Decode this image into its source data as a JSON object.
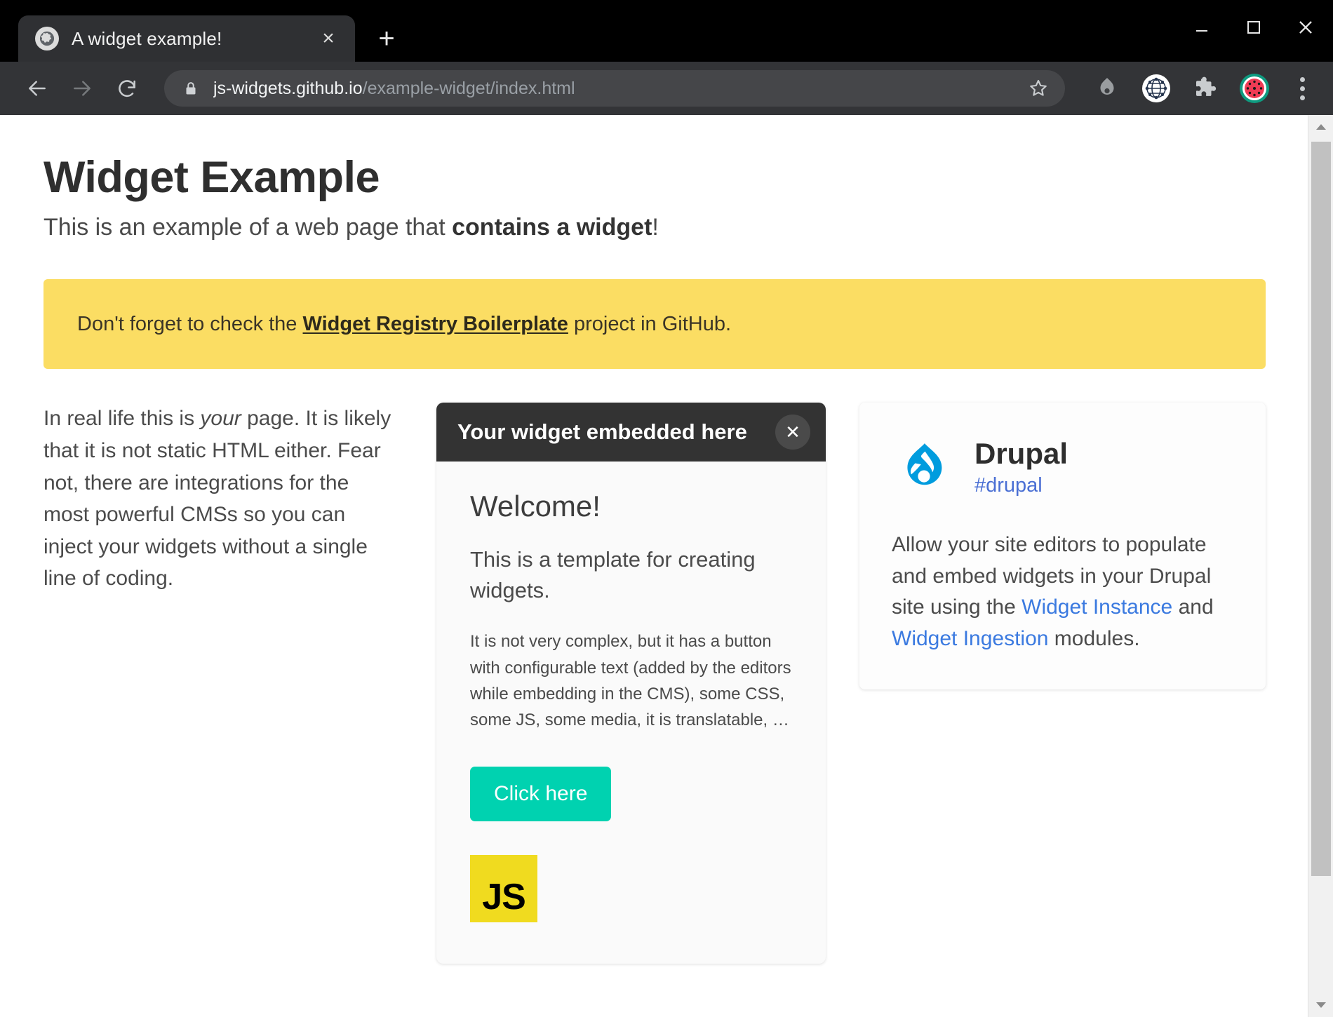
{
  "browser": {
    "tab": {
      "title": "A widget example!",
      "favicon": "globe-icon",
      "close_label": "×"
    },
    "new_tab_label": "+",
    "window_controls": {
      "minimize": "–",
      "maximize": "□",
      "close": "✕"
    },
    "omnibox": {
      "host": "js-widgets.github.io",
      "path": "/example-widget/index.html",
      "lock_icon": "lock-icon",
      "star_icon": "bookmark-star-icon"
    },
    "nav": {
      "back": "back-arrow-icon",
      "forward": "forward-arrow-icon",
      "reload": "reload-icon"
    },
    "extensions": [
      {
        "name": "drupal-extension-icon"
      },
      {
        "name": "globe-network-extension-icon"
      },
      {
        "name": "puzzle-extensions-icon"
      },
      {
        "name": "watermelon-profile-avatar"
      }
    ],
    "menu_icon": "three-dot-menu-icon"
  },
  "page": {
    "title": "Widget Example",
    "subtitle_pre": "This is an example of a web page that ",
    "subtitle_strong": "contains a widget",
    "subtitle_post": "!",
    "alert": {
      "pre": "Don't forget to check the ",
      "link": "Widget Registry Boilerplate",
      "post": " project in GitHub."
    },
    "left_column": {
      "pre": "In real life this is ",
      "em": "your",
      "post": " page. It is likely that it is not static HTML either. Fear not, there are integrations for the most powerful CMSs so you can inject your widgets without a single line of coding."
    },
    "widget": {
      "header_title": "Your widget embedded here",
      "close_label": "✕",
      "heading": "Welcome!",
      "lead": "This is a template for creating widgets.",
      "detail": "It is not very complex, but it has a button with configurable text (added by the editors while embedding in the CMS), some CSS, some JS, some media, it is translatable, …",
      "cta_label": "Click here",
      "media_logo": "JS"
    },
    "drupal_card": {
      "logo": "drupal-drop-logo",
      "name": "Drupal",
      "tag": "#drupal",
      "body_pre": "Allow your site editors to populate and embed widgets in your Drupal site using the ",
      "link_one": "Widget Instance",
      "body_mid": " and ",
      "link_two": "Widget Ingestion",
      "body_post": " modules."
    }
  },
  "colors": {
    "alert_bg": "#fbdd63",
    "cta_bg": "#00d2b0",
    "drupal_blue": "#009cde",
    "link_blue": "#3b7ae0",
    "js_yellow": "#f0db1f",
    "widget_header_bg": "#333333"
  }
}
